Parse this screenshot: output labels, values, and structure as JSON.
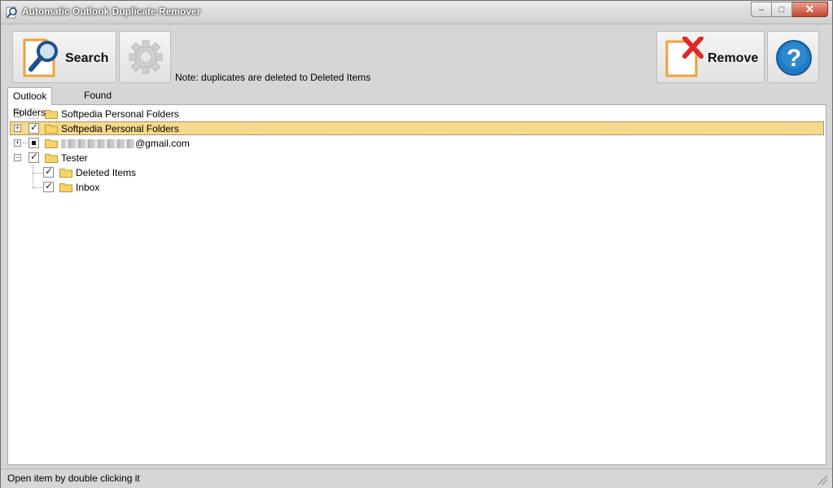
{
  "window": {
    "title": "Automatic Outlook Duplicate Remover",
    "controls": {
      "minimize": "–",
      "maximize": "□",
      "close": "✕"
    }
  },
  "toolbar": {
    "search_label": "Search",
    "settings_icon": "gear-icon",
    "remove_label": "Remove",
    "help_icon": "question-icon",
    "note": "Note: duplicates are deleted to Deleted Items"
  },
  "tabs": [
    {
      "label": "Outlook Folders",
      "active": true
    },
    {
      "label": "Found Duplicates",
      "active": false
    }
  ],
  "tree": [
    {
      "label": "Softpedia Personal Folders",
      "state": "unchecked-disabled",
      "expander": "+",
      "selected": false
    },
    {
      "label": "Softpedia Personal Folders",
      "state": "checked",
      "expander": "+",
      "selected": true
    },
    {
      "label": "@gmail.com",
      "state": "indeterminate",
      "expander": "+",
      "selected": false,
      "redacted_prefix": true
    },
    {
      "label": "Tester",
      "state": "checked",
      "expander": "−",
      "selected": false
    },
    {
      "label": "Deleted Items",
      "state": "checked",
      "expander": "",
      "selected": false,
      "level": 1
    },
    {
      "label": "Inbox",
      "state": "checked",
      "expander": "",
      "selected": false,
      "level": 1
    }
  ],
  "status": {
    "text": "Open item by double clicking it"
  },
  "colors": {
    "selection": "#f8d98b",
    "accent_orange": "#f0a03a",
    "accent_blue": "#1f6fb0",
    "close_red": "#d64a34",
    "remove_x": "#e02828"
  }
}
